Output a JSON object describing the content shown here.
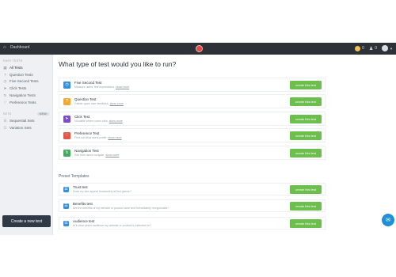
{
  "topbar": {
    "home_label": "Dashboard",
    "credits_a": "0",
    "credits_b": "0"
  },
  "sidebar": {
    "section_tests": "EASY TESTS",
    "items": [
      {
        "label": "All Tests",
        "icon": "grid-icon",
        "active": true
      },
      {
        "label": "Question Tests",
        "icon": "question-icon"
      },
      {
        "label": "Five Second Tests",
        "icon": "clock-icon"
      },
      {
        "label": "Click Tests",
        "icon": "cursor-icon"
      },
      {
        "label": "Navigation Tests",
        "icon": "navigation-icon"
      },
      {
        "label": "Preference Tests",
        "icon": "heart-icon"
      }
    ],
    "section_sets": "SETS",
    "sets_badge": "NEW",
    "sets": [
      {
        "label": "Sequential Sets",
        "icon": "list-icon"
      },
      {
        "label": "Variation Sets",
        "icon": "variation-icon"
      }
    ],
    "create_label": "Create a new test"
  },
  "main": {
    "title": "What type of test would you like to run?",
    "tests": [
      {
        "name": "Five Second Test",
        "desc": "Measure users' first impressions.",
        "more": "show more",
        "button": "create this test",
        "color": "#3b8fd6",
        "icon": "clock-icon"
      },
      {
        "name": "Question Test",
        "desc": "Gather quick user feedback.",
        "more": "show more",
        "button": "create this test",
        "color": "#f0a93b",
        "icon": "question-icon"
      },
      {
        "name": "Click Test",
        "desc": "Visualise where users click.",
        "more": "show more",
        "button": "create this test",
        "color": "#7b4fc4",
        "icon": "cursor-icon"
      },
      {
        "name": "Preference Test",
        "desc": "Find out what users prefer.",
        "more": "show more",
        "button": "create this test",
        "color": "#e0584a",
        "icon": "heart-icon"
      },
      {
        "name": "Navigation Test",
        "desc": "See how users navigate.",
        "more": "show more",
        "button": "create this test",
        "color": "#4aa864",
        "icon": "navigation-icon"
      }
    ],
    "preset_title": "Preset Templates",
    "presets": [
      {
        "name": "Trust test",
        "desc": "Does my site appear trustworthy at first glance?",
        "button": "create this test",
        "color": "#3b8fd6",
        "icon": "template-icon"
      },
      {
        "name": "Benefits test",
        "desc": "Are the benefits of my website or product clear and immediately recognizable?",
        "button": "create this test",
        "color": "#3b8fd6",
        "icon": "template-icon"
      },
      {
        "name": "Audience test",
        "desc": "Is it clear which audience my website or product is intended for?",
        "button": "create this test",
        "color": "#3b8fd6",
        "icon": "template-icon"
      }
    ]
  }
}
